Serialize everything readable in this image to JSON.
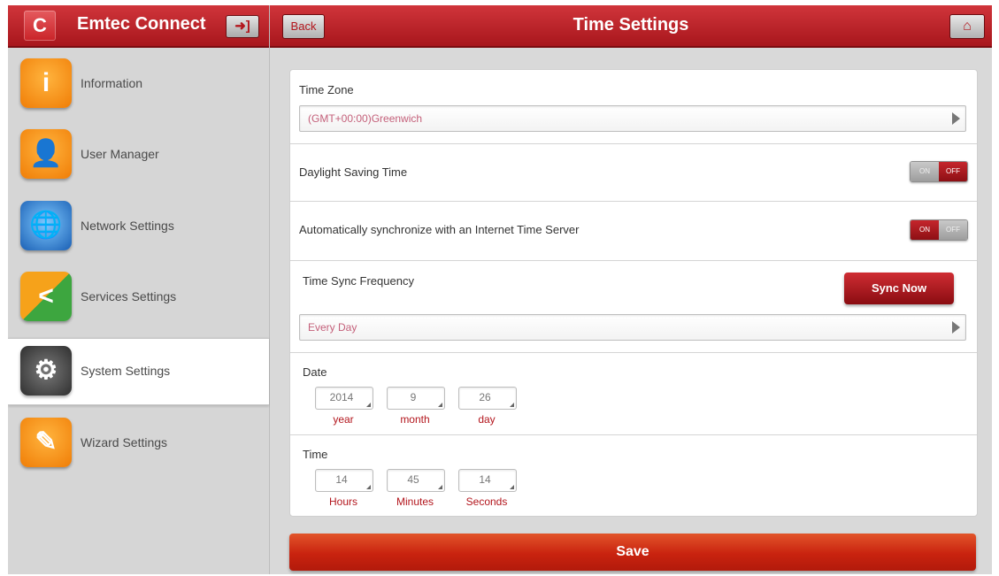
{
  "sidebar": {
    "logo_glyph": "C",
    "title": "Emtec Connect",
    "logout_glyph": "➜]",
    "items": [
      {
        "label": "Information",
        "glyph": "i"
      },
      {
        "label": "User Manager",
        "glyph": "👤"
      },
      {
        "label": "Network Settings",
        "glyph": "🌐"
      },
      {
        "label": "Services Settings",
        "glyph": "<"
      },
      {
        "label": "System Settings",
        "glyph": "⚙"
      },
      {
        "label": "Wizard Settings",
        "glyph": "✎"
      }
    ]
  },
  "header": {
    "back_label": "Back",
    "title": "Time Settings",
    "home_glyph": "⌂"
  },
  "settings": {
    "timezone": {
      "label": "Time Zone",
      "value": "(GMT+00:00)Greenwich"
    },
    "dst": {
      "label": "Daylight Saving Time",
      "on": "ON",
      "off": "OFF",
      "state": "off"
    },
    "autosync": {
      "label": "Automatically synchronize with an Internet Time Server",
      "on": "ON",
      "off": "OFF",
      "state": "on"
    },
    "frequency": {
      "label": "Time Sync Frequency",
      "value": "Every Day",
      "sync_label": "Sync Now"
    },
    "date": {
      "label": "Date",
      "year": "2014",
      "month": "9",
      "day": "26",
      "year_label": "year",
      "month_label": "month",
      "day_label": "day"
    },
    "time": {
      "label": "Time",
      "hours": "14",
      "minutes": "45",
      "seconds": "14",
      "hours_label": "Hours",
      "minutes_label": "Minutes",
      "seconds_label": "Seconds"
    }
  },
  "save_label": "Save",
  "colors": {
    "brand_red": "#b3161d",
    "toggle_red": "#a3151b",
    "save_orange": "#c9230f"
  }
}
